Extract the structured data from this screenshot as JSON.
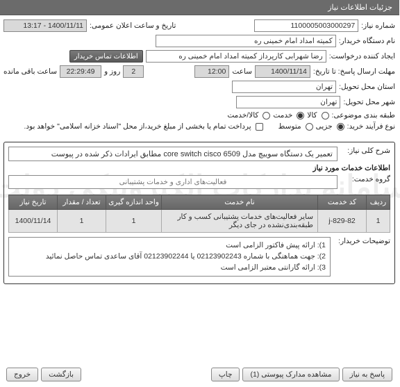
{
  "header": {
    "title": "جزئیات اطلاعات نیاز"
  },
  "form": {
    "need_no_label": "شماره نیاز:",
    "need_no": "1100005003000297",
    "pub_date_label": "تاریخ و ساعت اعلان عمومی:",
    "pub_date": "1400/11/11 - 13:17",
    "org_label": "نام دستگاه خریدار:",
    "org": "کمیته امداد امام خمینی ره",
    "creator_label": "ایجاد کننده درخواست:",
    "creator": "رضا شهرابی کارپرداز کمیته امداد امام خمینی ره",
    "contact_btn": "اطلاعات تماس خریدار",
    "deadline_label": "مهلت ارسال پاسخ: تا تاریخ:",
    "deadline_date": "1400/11/14",
    "time_label": "ساعت",
    "deadline_time": "12:00",
    "days_remaining": "2",
    "days_and": "روز و",
    "time_remaining": "22:29:49",
    "remaining_label": "ساعت باقی مانده",
    "province_label": "استان محل تحویل:",
    "province": "تهران",
    "city_label": "شهر محل تحویل:",
    "city": "تهران",
    "subject_type_label": "طبقه بندی موضوعی:",
    "opt_goods": "کالا",
    "opt_service": "خدمت",
    "opt_both": "کالا/خدمت",
    "purchase_type_label": "نوع فرآیند خرید:",
    "opt_minor": "جزیی",
    "opt_medium": "متوسط",
    "payment_note": "پرداخت تمام یا بخشی از مبلغ خرید،از محل \"اسناد خزانه اسلامی\" خواهد بود."
  },
  "desc": {
    "need_title_label": "شرح کلی نیاز:",
    "need_title": "تعمیر یک دستگاه سوییچ  مدل core switch cisco  6509 مطابق ایرادات ذکر شده در پیوست",
    "services_label": "اطلاعات خدمات مورد نیاز",
    "group_label": "گروه خدمت:",
    "group": "فعالیت‌های اداری و خدمات پشتیبانی"
  },
  "table": {
    "h_row": "ردیف",
    "h_code": "کد خدمت",
    "h_name": "نام خدمت",
    "h_unit": "واحد اندازه گیری",
    "h_qty": "تعداد / مقدار",
    "h_date": "تاریخ نیاز",
    "rows": [
      {
        "row": "1",
        "code": "829-82-j",
        "name": "سایر فعالیت‌های خدمات پشتیبانی کسب و کار طبقه‌بندی‌نشده در جای دیگر",
        "unit": "1",
        "qty": "1",
        "date": "1400/11/14"
      }
    ]
  },
  "notes": {
    "label": "توضیحات خریدار:",
    "l1": "1): ارائه پیش فاکتور الزامی است",
    "l2": "2): جهت هماهنگی با شماره 02123902243 یا 02123902244 آقای ساعدی تماس حاصل نمائید",
    "l3": "3): ارائه گارانتی معتبر الزامی است"
  },
  "footer": {
    "reply": "پاسخ به نیاز",
    "attach": "مشاهده مدارک پیوستی (1)",
    "print": "چاپ",
    "back": "بازگشت",
    "exit": "خروج"
  },
  "wm": {
    "t1": "سامانه تدارکات الکترونیکی دولت",
    "t2": "۸۸۳۴۹۶۷ - ۰۲۱"
  }
}
